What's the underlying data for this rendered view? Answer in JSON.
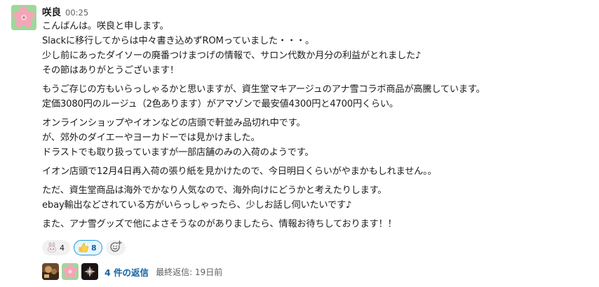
{
  "message": {
    "sender": "咲良",
    "timestamp": "00:25",
    "paragraphs": [
      {
        "lines": [
          "こんばんは。咲良と申します。",
          "Slackに移行してからは中々書き込めずROMっていました・・・。",
          "少し前にあったダイソーの廃番つけまつげの情報で、サロン代数か月分の利益がとれました♪",
          "その節はありがとうございます！"
        ]
      },
      {
        "lines": [
          "もうご存じの方もいらっしゃるかと思いますが、資生堂マキアージュのアナ雪コラボ商品が高騰しています。",
          "定価3080円のルージュ（2色あります）がアマゾンで最安値4300円と4700円くらい。"
        ]
      },
      {
        "lines": [
          "オンラインショップやイオンなどの店頭で軒並み品切れ中です。",
          "が、郊外のダイエーやヨーカドーでは見かけました。",
          "ドラストでも取り扱っていますが一部店舗のみの入荷のようです。"
        ]
      },
      {
        "lines": [
          "イオン店頭で12月4日再入荷の張り紙を見かけたので、今日明日くらいがやまかもしれません。。"
        ]
      },
      {
        "lines": [
          "ただ、資生堂商品は海外でかなり人気なので、海外向けにどうかと考えたりします。",
          "ebay輸出などされている方がいらっしゃったら、少しお話し伺いたいです♪"
        ]
      },
      {
        "lines": [
          "また、アナ雪グッズで他によさそうなのがありましたら、情報お待ちしております！！"
        ]
      }
    ]
  },
  "reactions": [
    {
      "icon": "rabbit-emoji",
      "count": "4",
      "active": false
    },
    {
      "icon": "thumbs-up-emoji",
      "count": "8",
      "active": true
    }
  ],
  "add_reaction_icon": "add-reaction-icon",
  "thread": {
    "reply_count": "4 件の返信",
    "last_reply": "最終返信: 19日前"
  },
  "colors": {
    "link": "#1264a3",
    "active_reaction_bg": "#e8f5fa",
    "active_reaction_border": "#1d9bd1",
    "avatar_bg": "#8ecf8a"
  }
}
